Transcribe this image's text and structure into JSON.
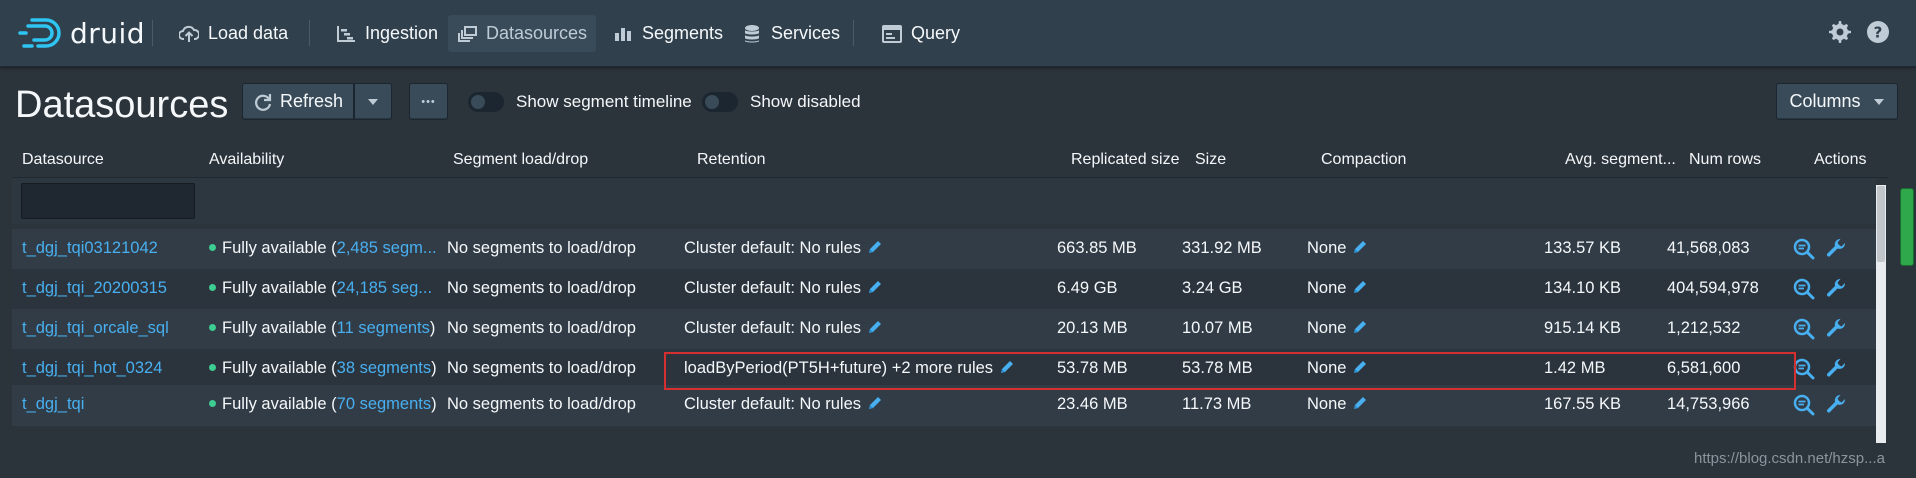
{
  "app": {
    "logo_text": "druid"
  },
  "nav": {
    "items": [
      {
        "label": "Load data",
        "icon": "cloud-upload-icon"
      },
      {
        "label": "Ingestion",
        "icon": "gantt-chart-icon"
      },
      {
        "label": "Datasources",
        "icon": "multi-select-icon",
        "active": true
      },
      {
        "label": "Segments",
        "icon": "stacked-chart-icon"
      },
      {
        "label": "Services",
        "icon": "database-icon"
      },
      {
        "label": "Query",
        "icon": "application-icon"
      }
    ],
    "right_icons": [
      "gear-icon",
      "help-icon"
    ]
  },
  "page": {
    "title": "Datasources",
    "refresh_label": "Refresh",
    "more_label": "•••",
    "toggle_timeline": "Show segment timeline",
    "toggle_disabled": "Show disabled",
    "columns_label": "Columns"
  },
  "table": {
    "headers": [
      "Datasource",
      "Availability",
      "Segment load/drop",
      "Retention",
      "Replicated size",
      "Size",
      "Compaction",
      "Avg. segment...",
      "Num rows",
      "Actions"
    ],
    "rows": [
      {
        "datasource": "t_dgj_tqi03121042",
        "avail_prefix": "Fully available (",
        "avail_link": "2,485 segm...",
        "avail_suffix": "",
        "load_drop": "No segments to load/drop",
        "retention": "Cluster default: No rules",
        "replicated_size": "663.85 MB",
        "size": "331.92 MB",
        "compaction": "None",
        "avg_segment": "133.57 KB",
        "num_rows": "41,568,083"
      },
      {
        "datasource": "t_dgj_tqi_20200315",
        "avail_prefix": "Fully available (",
        "avail_link": "24,185 seg...",
        "avail_suffix": "",
        "load_drop": "No segments to load/drop",
        "retention": "Cluster default: No rules",
        "replicated_size": "6.49 GB",
        "size": "3.24 GB",
        "compaction": "None",
        "avg_segment": "134.10 KB",
        "num_rows": "404,594,978"
      },
      {
        "datasource": "t_dgj_tqi_orcale_sql",
        "avail_prefix": "Fully available (",
        "avail_link": "11 segments",
        "avail_suffix": ")",
        "load_drop": "No segments to load/drop",
        "retention": "Cluster default: No rules",
        "replicated_size": "20.13 MB",
        "size": "10.07 MB",
        "compaction": "None",
        "avg_segment": "915.14 KB",
        "num_rows": "1,212,532"
      },
      {
        "datasource": "t_dgj_tqi_hot_0324",
        "avail_prefix": "Fully available (",
        "avail_link": "38 segments",
        "avail_suffix": ")",
        "load_drop": "No segments to load/drop",
        "retention": "loadByPeriod(PT5H+future) +2 more rules",
        "replicated_size": "53.78 MB",
        "size": "53.78 MB",
        "compaction": "None",
        "avg_segment": "1.42 MB",
        "num_rows": "6,581,600"
      },
      {
        "datasource": "t_dgj_tqi",
        "avail_prefix": "Fully available (",
        "avail_link": "70 segments",
        "avail_suffix": ")",
        "load_drop": "No segments to load/drop",
        "retention": "Cluster default: No rules",
        "replicated_size": "23.46 MB",
        "size": "11.73 MB",
        "compaction": "None",
        "avg_segment": "167.55 KB",
        "num_rows": "14,753,966"
      }
    ],
    "action_icons": [
      "search-template-icon",
      "wrench-icon"
    ]
  },
  "watermark": "https://blog.csdn.net/hzsp...a",
  "colors": {
    "link": "#48aff0",
    "available_dot": "#3dcc91",
    "highlight": "#d62f2f",
    "background": "#2b333b",
    "navbar": "#30404d"
  }
}
